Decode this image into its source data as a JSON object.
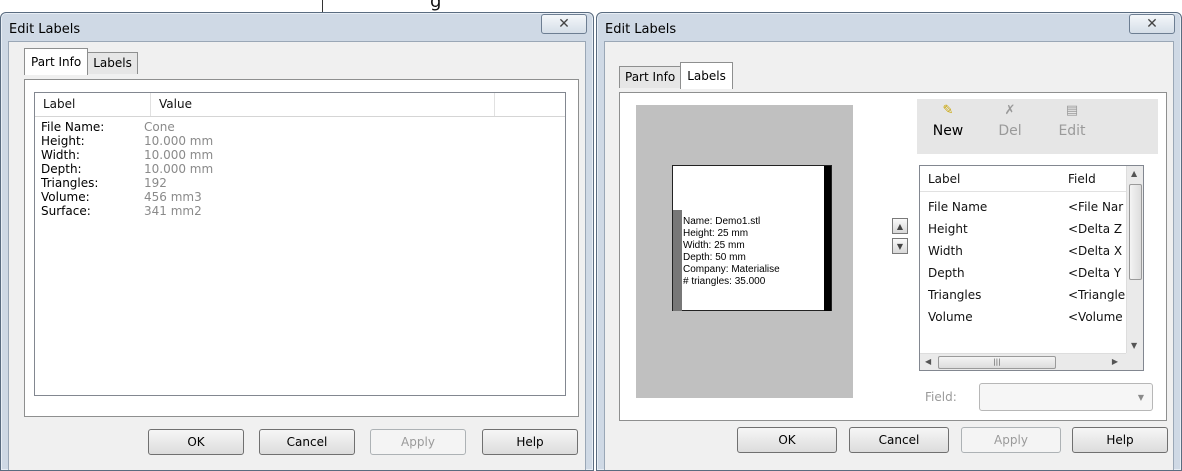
{
  "top_note": "g",
  "left_dialog": {
    "title": "Edit Labels",
    "tabs": [
      {
        "label": "Part Info",
        "active": true
      },
      {
        "label": "Labels",
        "active": false
      }
    ],
    "columns": [
      "Label",
      "Value"
    ],
    "rows": [
      {
        "label": "File Name:",
        "value": "Cone"
      },
      {
        "label": "Height:",
        "value": "10.000 mm"
      },
      {
        "label": "Width:",
        "value": "10.000 mm"
      },
      {
        "label": "Depth:",
        "value": "10.000 mm"
      },
      {
        "label": "Triangles:",
        "value": "192"
      },
      {
        "label": "Volume:",
        "value": "456 mm3"
      },
      {
        "label": "Surface:",
        "value": "341 mm2"
      }
    ],
    "buttons": {
      "ok": "OK",
      "cancel": "Cancel",
      "apply": "Apply",
      "help": "Help"
    }
  },
  "right_dialog": {
    "title": "Edit Labels",
    "tabs": [
      {
        "label": "Part Info",
        "active": false
      },
      {
        "label": "Labels",
        "active": true
      }
    ],
    "preview_lines": [
      "Name: Demo1.stl",
      "Height: 25 mm",
      "Width: 25 mm",
      "Depth: 50 mm",
      "Company: Materialise",
      "# triangles: 35.000"
    ],
    "toolbar": {
      "new": {
        "label": "New",
        "icon": "new-label-icon"
      },
      "del": {
        "label": "Del",
        "icon": "delete-label-icon"
      },
      "edit": {
        "label": "Edit",
        "icon": "edit-label-icon"
      }
    },
    "list_columns": [
      "Label",
      "Field"
    ],
    "list_rows": [
      {
        "label": "File Name",
        "field": "<File Nar"
      },
      {
        "label": "Height",
        "field": "<Delta Z"
      },
      {
        "label": "Width",
        "field": "<Delta X"
      },
      {
        "label": "Depth",
        "field": "<Delta Y"
      },
      {
        "label": "Triangles",
        "field": "<Triangle"
      },
      {
        "label": "Volume",
        "field": "<Volume"
      }
    ],
    "field_label": "Field:",
    "field_value": "",
    "buttons": {
      "ok": "OK",
      "cancel": "Cancel",
      "apply": "Apply",
      "help": "Help"
    }
  }
}
